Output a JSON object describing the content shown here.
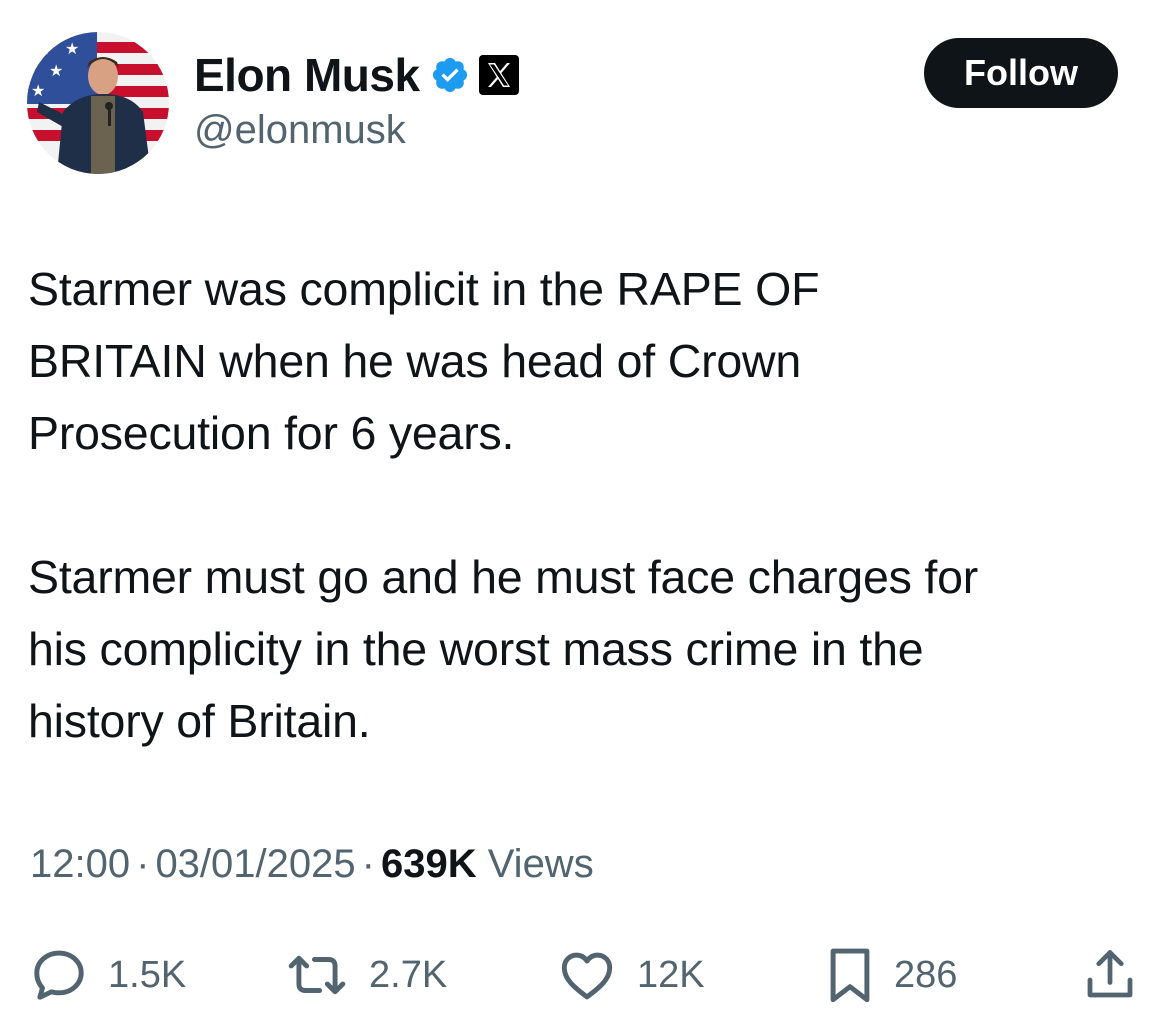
{
  "author": {
    "display_name": "Elon Musk",
    "handle": "@elonmusk",
    "verified": true,
    "affiliation_badge": "x-logo-icon"
  },
  "follow_button": {
    "label": "Follow"
  },
  "tweet": {
    "text": "Starmer was complicit in the RAPE OF\nBRITAIN when he was head of Crown\nProsecution for 6 years.\n\nStarmer must go and he must face charges for\nhis complicity in the worst mass crime in the\nhistory of Britain."
  },
  "meta": {
    "time": "12:00",
    "separator": "·",
    "date": "03/01/2025",
    "views_count": "639K",
    "views_label": "Views"
  },
  "actions": {
    "replies": "1.5K",
    "reposts": "2.7K",
    "likes": "12K",
    "bookmarks": "286"
  },
  "colors": {
    "text": "#0f1419",
    "secondary": "#536471",
    "verified": "#1d9bf0",
    "button_bg": "#0f1419",
    "button_text": "#ffffff"
  }
}
